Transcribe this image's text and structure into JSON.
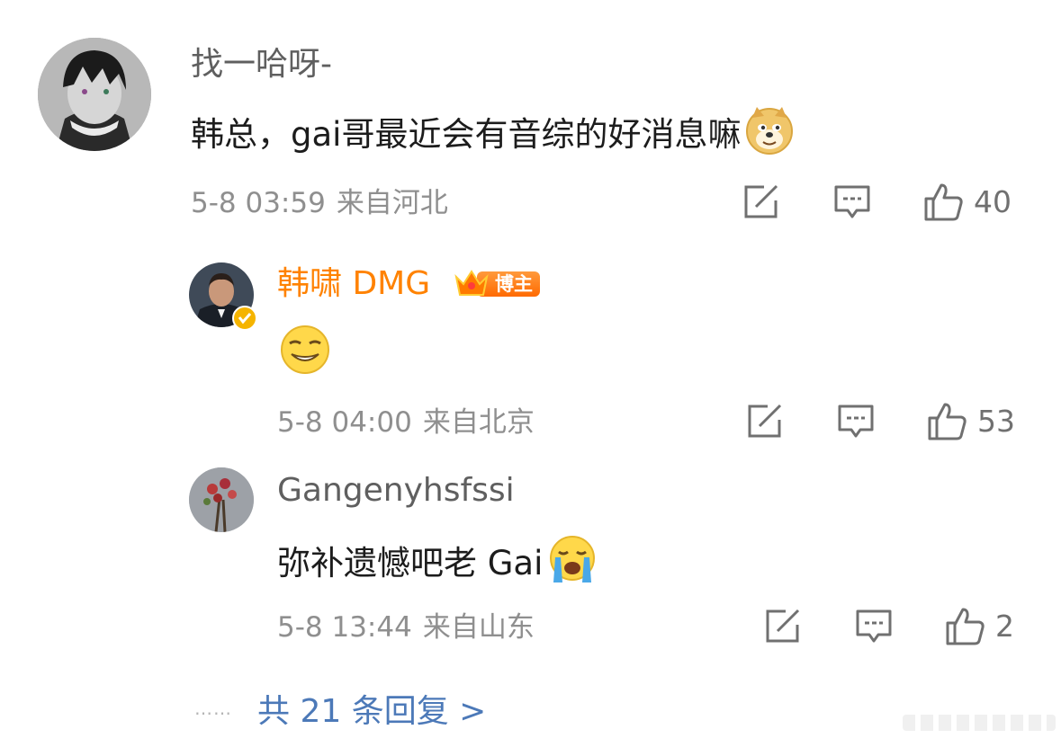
{
  "comment": {
    "username": "找一哈呀-",
    "text": "韩总，gai哥最近会有音综的好消息嘛",
    "time": "5-8 03:59",
    "location": "来自河北",
    "like_count": "40"
  },
  "replies": [
    {
      "username": "韩啸 DMG",
      "badge": "博主",
      "time": "5-8 04:00",
      "location": "来自北京",
      "like_count": "53"
    },
    {
      "username": "Gangenyhsfssi",
      "text": "弥补遗憾吧老 Gai",
      "time": "5-8 13:44",
      "location": "来自山东",
      "like_count": "2"
    }
  ],
  "more_replies": {
    "dots": "……",
    "label": "共 21 条回复 >"
  },
  "icons": [
    "share-icon",
    "comment-icon",
    "like-icon",
    "doge-emoji-icon",
    "smirk-emoji-icon",
    "crying-emoji-icon",
    "verified-badge-icon",
    "crown-icon"
  ],
  "colors": {
    "blogger_name": "#ff8200",
    "link": "#4c79b8",
    "meta": "#8f8f8f",
    "username": "#5f5f5f"
  }
}
